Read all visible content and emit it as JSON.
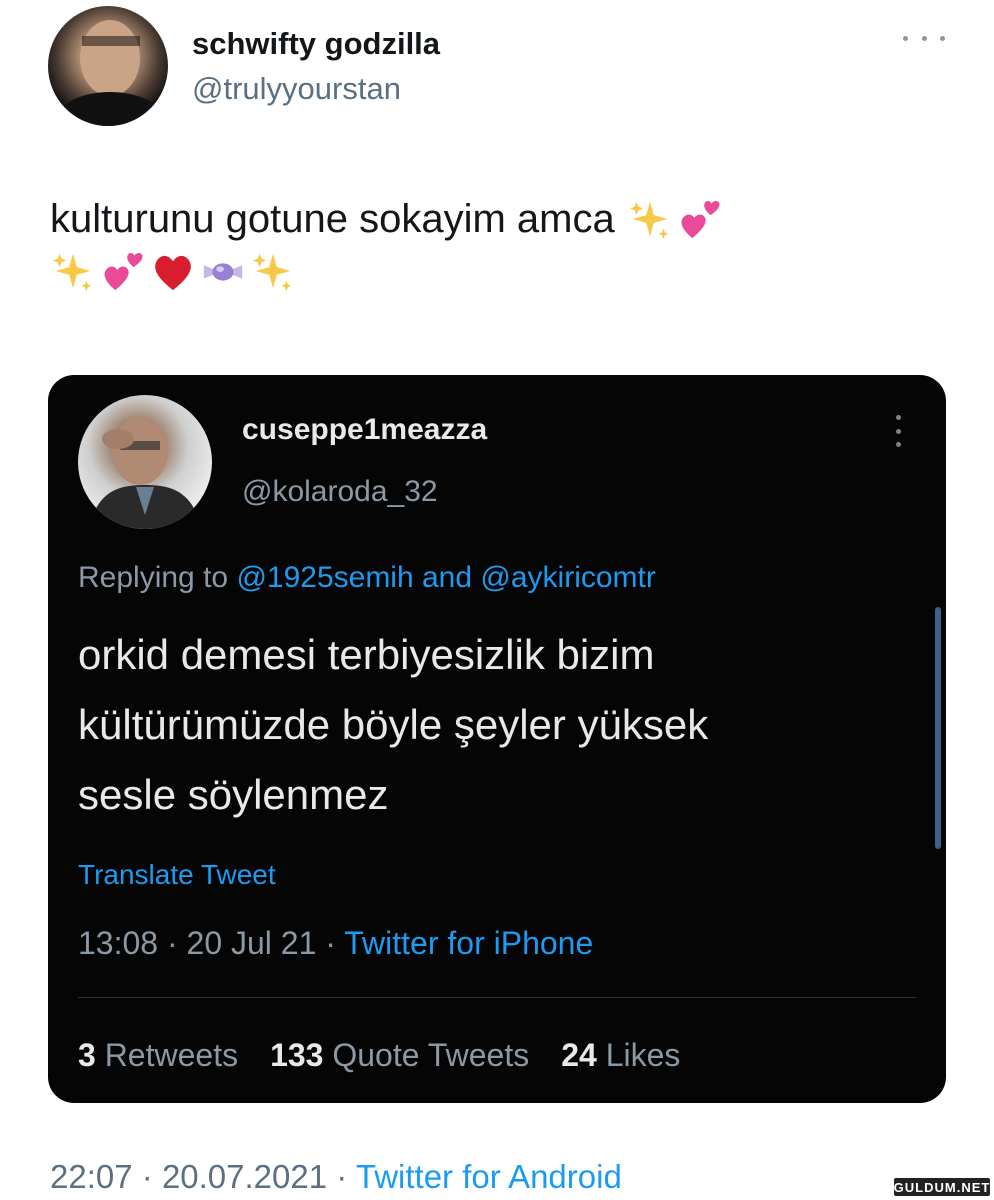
{
  "outer_tweet": {
    "display_name": "schwifty godzilla",
    "handle": "@trulyyourstan",
    "text": "kulturunu gotune sokayim amca",
    "emojis_line1": [
      "sparkles-emoji",
      "two-hearts-emoji"
    ],
    "emojis_line2": [
      "sparkles-emoji",
      "two-hearts-emoji",
      "red-heart-emoji",
      "candy-emoji",
      "sparkles-emoji"
    ],
    "time": "22:07",
    "date": "20.07.2021",
    "source": "Twitter for Android"
  },
  "quoted_screenshot": {
    "display_name": "cuseppe1meazza",
    "handle": "@kolaroda_32",
    "replying_prefix": "Replying to",
    "reply_mention_1": "@1925semih",
    "reply_and": "and",
    "reply_mention_2": "@aykiricomtr",
    "text_lines": [
      "orkid demesi terbiyesizlik bizim",
      "kültürümüzde böyle şeyler yüksek",
      "sesle söylenmez"
    ],
    "translate_label": "Translate Tweet",
    "time": "13:08",
    "date": "20 Jul 21",
    "source": "Twitter for iPhone",
    "stats": {
      "retweets_count": "3",
      "retweets_label": "Retweets",
      "quotes_count": "133",
      "quotes_label": "Quote Tweets",
      "likes_count": "24",
      "likes_label": "Likes"
    }
  },
  "watermark": "GULDUM.NET",
  "colors": {
    "link_blue": "#1d9bf0",
    "muted_gray": "#5b7083",
    "dark_card_bg": "#050505"
  }
}
